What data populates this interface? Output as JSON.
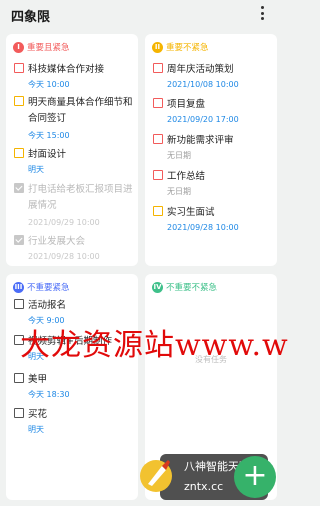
{
  "app": {
    "title": "四象限"
  },
  "menu_icon": "more-vertical-icon",
  "quadrants": [
    {
      "badge": "I",
      "name": "重要且紧急",
      "color": "#f25b5b",
      "tasks": [
        {
          "text": "科技媒体合作对接",
          "date": "今天 10:00",
          "checkbox_color": "#f25b5b",
          "done": false
        },
        {
          "text": "明天商量具体合作细节和合同签订",
          "date": "今天 15:00",
          "checkbox_color": "#f5b400",
          "done": false
        },
        {
          "text": "封面设计",
          "date": "明天",
          "checkbox_color": "#f5b400",
          "done": false
        },
        {
          "text": "打电话给老板汇报项目进展情况",
          "date": "2021/09/29 10:00",
          "done": true
        },
        {
          "text": "行业发展大会",
          "date": "2021/09/28 10:00",
          "done": true
        }
      ]
    },
    {
      "badge": "II",
      "name": "重要不紧急",
      "color": "#f5b400",
      "tasks": [
        {
          "text": "周年庆活动策划",
          "date": "2021/10/08 10:00",
          "checkbox_color": "#f25b5b",
          "done": false
        },
        {
          "text": "项目复盘",
          "date": "2021/09/20 17:00",
          "checkbox_color": "#f25b5b",
          "done": false
        },
        {
          "text": "新功能需求评审",
          "date": "无日期",
          "checkbox_color": "#f25b5b",
          "done": false
        },
        {
          "text": "工作总结",
          "date": "无日期",
          "checkbox_color": "#f25b5b",
          "done": false
        },
        {
          "text": "实习生面试",
          "date": "2021/09/28 10:00",
          "checkbox_color": "#f5b400",
          "done": false
        }
      ]
    },
    {
      "badge": "III",
      "name": "不重要紧急",
      "color": "#4a6cf7",
      "tasks": [
        {
          "text": "活动报名",
          "date": "今天 9:00",
          "checkbox_color": "#555555",
          "done": false
        },
        {
          "text": "视频剪辑+后期制作",
          "date": "明天",
          "checkbox_color": "#555555",
          "done": false
        },
        {
          "text": "美甲",
          "date": "今天 18:30",
          "checkbox_color": "#555555",
          "done": false
        },
        {
          "text": "买花",
          "date": "明天",
          "checkbox_color": "#555555",
          "done": false
        }
      ]
    },
    {
      "badge": "IV",
      "name": "不重要不紧急",
      "color": "#3ec08a",
      "tasks": [],
      "empty_text": "没有任务"
    }
  ],
  "watermark": "大龙资源站www.w",
  "promo": {
    "line1": "八神智能天下",
    "line2": "zntx.cc"
  },
  "fab": {
    "label": "+"
  }
}
